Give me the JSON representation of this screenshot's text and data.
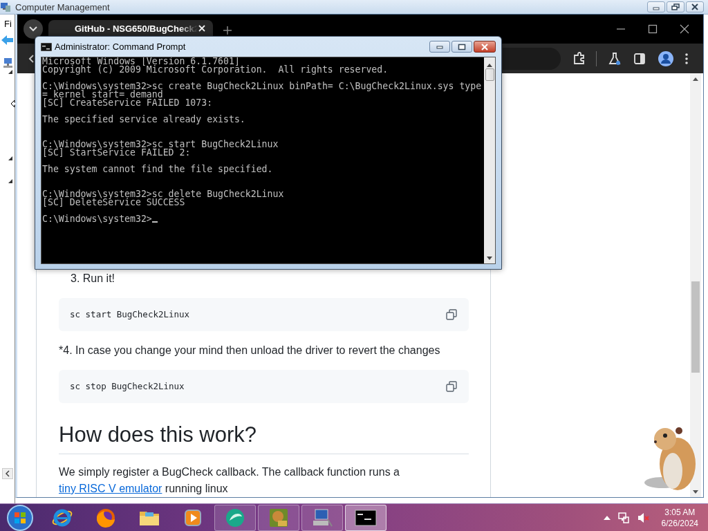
{
  "background_window": {
    "title": "Computer Management",
    "menu": [
      "Fi"
    ]
  },
  "browser": {
    "tabs": [
      {
        "title": "GitHub - NSG650/BugCheck2",
        "selected": true
      }
    ],
    "content": [
      {
        "kind": "step",
        "text": "3. Run it!"
      },
      {
        "kind": "code",
        "text": "sc start BugCheck2Linux"
      },
      {
        "kind": "paragraph",
        "text": "*4. In case you change your mind then unload the driver to revert the changes"
      },
      {
        "kind": "code",
        "text": "sc stop BugCheck2Linux"
      },
      {
        "kind": "heading",
        "text": "How does this work?"
      },
      {
        "kind": "paragraph",
        "text": "We simply register a BugCheck callback. The callback function runs a ",
        "link": "tiny RISC V emulator",
        "after": " running linux"
      }
    ]
  },
  "console": {
    "title": "Administrator:  Command Prompt",
    "cursor_visible": true,
    "blocks": [
      {
        "kind": "first",
        "lines": [
          "Microsoft Windows [Version 6.1.7601]",
          "Copyright (c) 2009 Microsoft Corporation.  All rights reserved."
        ]
      },
      {
        "kind": "after_blank",
        "lines": [
          "C:\\Windows\\system32>sc create BugCheck2Linux binPath= C:\\BugCheck2Linux.sys type",
          "= kernel start= demand",
          "[SC] CreateService FAILED 1073:"
        ]
      },
      {
        "kind": "after_blank",
        "lines": [
          "The specified service already exists."
        ]
      },
      {
        "kind": "after_two_blanks",
        "lines": [
          "C:\\Windows\\system32>sc start BugCheck2Linux",
          "[SC] StartService FAILED 2:"
        ]
      },
      {
        "kind": "after_blank",
        "lines": [
          "The system cannot find the file specified."
        ]
      },
      {
        "kind": "after_two_blanks",
        "lines": [
          "C:\\Windows\\system32>sc delete BugCheck2Linux",
          "[SC] DeleteService SUCCESS"
        ]
      },
      {
        "kind": "after_blank",
        "lines": [
          "C:\\Windows\\system32>"
        ]
      }
    ]
  },
  "taskbar": {
    "apps": [
      {
        "running": false,
        "selected": false
      },
      {
        "running": false,
        "selected": false
      },
      {
        "running": false,
        "selected": false
      },
      {
        "running": false,
        "selected": false
      },
      {
        "running": true,
        "selected": false
      },
      {
        "running": true,
        "selected": false
      },
      {
        "running": true,
        "selected": false
      },
      {
        "running": true,
        "selected": true
      }
    ],
    "time": "3:05 AM",
    "date": "6/26/2024"
  }
}
